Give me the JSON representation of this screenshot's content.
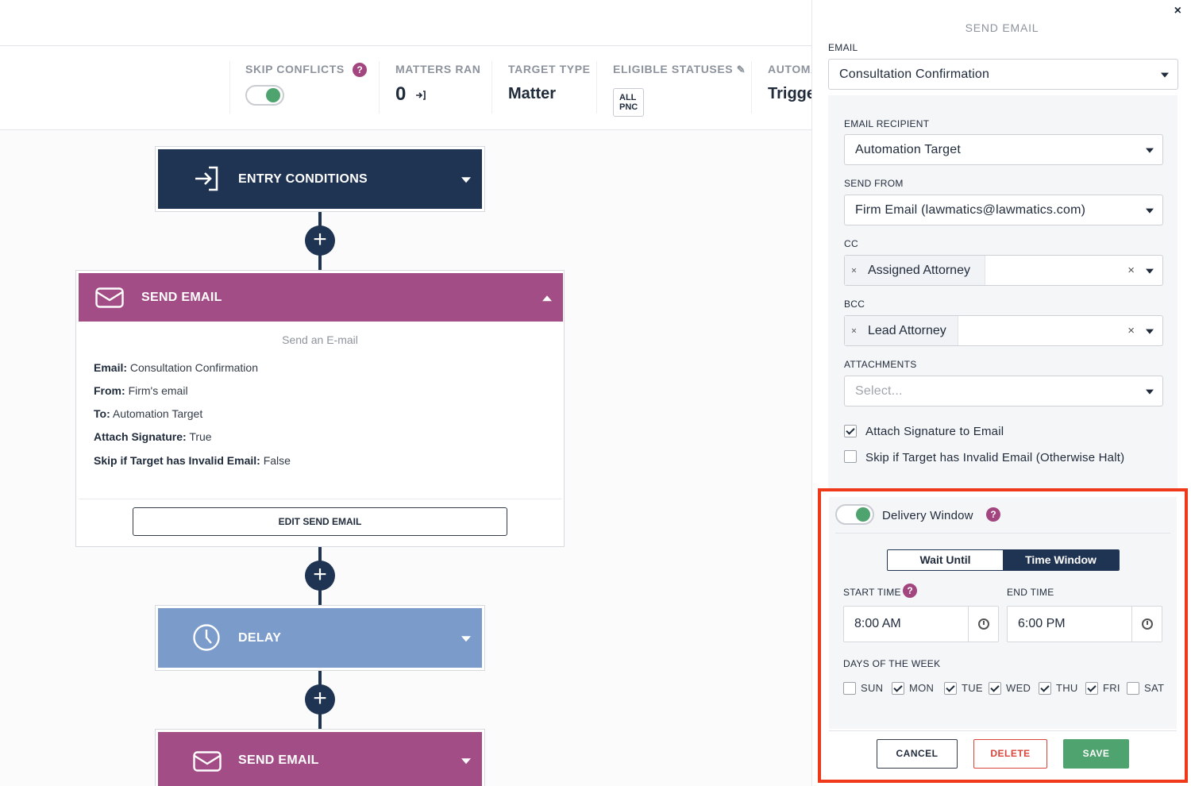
{
  "stats": {
    "skip_conflicts": {
      "label": "SKIP CONFLICTS",
      "help": "?",
      "enabled": true
    },
    "matters_ran": {
      "label": "MATTERS RAN",
      "value": "0"
    },
    "target_type": {
      "label": "TARGET TYPE",
      "value": "Matter"
    },
    "eligible_statuses": {
      "label": "ELIGIBLE STATUSES",
      "value": "ALL PNC"
    },
    "automation": {
      "label": "AUTOMA",
      "value": "Trigge"
    }
  },
  "flow": {
    "entry": {
      "title": "ENTRY CONDITIONS",
      "color": "#1f3352"
    },
    "send_email": {
      "title": "SEND EMAIL",
      "color": "#a34d86",
      "subtitle": "Send an E-mail",
      "details": [
        {
          "key": "Email:",
          "value": "Consultation Confirmation"
        },
        {
          "key": "From:",
          "value": "Firm's email"
        },
        {
          "key": "To:",
          "value": "Automation Target"
        },
        {
          "key": "Attach Signature:",
          "value": "True"
        },
        {
          "key": "Skip if Target has Invalid Email:",
          "value": "False"
        }
      ],
      "edit_label": "EDIT SEND EMAIL"
    },
    "delay": {
      "title": "DELAY",
      "color": "#7b9bcb"
    },
    "send_email_2": {
      "title": "SEND EMAIL",
      "color": "#a34d86"
    },
    "add_symbol": "+"
  },
  "panel": {
    "close": "×",
    "title": "SEND EMAIL",
    "email_label": "EMAIL",
    "email_value": "Consultation Confirmation",
    "recipient_label": "EMAIL RECIPIENT",
    "recipient_value": "Automation Target",
    "from_label": "SEND FROM",
    "from_value": "Firm Email (lawmatics@lawmatics.com)",
    "cc_label": "CC",
    "cc_tag": "Assigned Attorney",
    "bcc_label": "BCC",
    "bcc_tag": "Lead Attorney",
    "tag_remove": "×",
    "clear": "×",
    "attachments_label": "ATTACHMENTS",
    "attachments_placeholder": "Select...",
    "attach_signature": {
      "label": "Attach Signature to Email",
      "checked": true
    },
    "skip_invalid": {
      "label": "Skip if Target has Invalid Email (Otherwise Halt)",
      "checked": false
    },
    "delivery_window": {
      "label": "Delivery Window",
      "help": "?",
      "enabled": true,
      "modes": [
        "Wait Until",
        "Time Window"
      ],
      "active_mode": "Time Window",
      "start_label": "START TIME",
      "start_value": "8:00 AM",
      "end_label": "END TIME",
      "end_value": "6:00 PM",
      "days_label": "DAYS OF THE WEEK",
      "days": [
        {
          "label": "SUN",
          "checked": false
        },
        {
          "label": "MON",
          "checked": true
        },
        {
          "label": "TUE",
          "checked": true
        },
        {
          "label": "WED",
          "checked": true
        },
        {
          "label": "THU",
          "checked": true
        },
        {
          "label": "FRI",
          "checked": true
        },
        {
          "label": "SAT",
          "checked": false
        }
      ]
    },
    "buttons": {
      "cancel": "CANCEL",
      "delete": "DELETE",
      "save": "SAVE"
    },
    "colors": {
      "save": "#4fa36e",
      "delete": "#d9453b",
      "highlight": "#f0391b",
      "accent": "#a3457f"
    }
  }
}
